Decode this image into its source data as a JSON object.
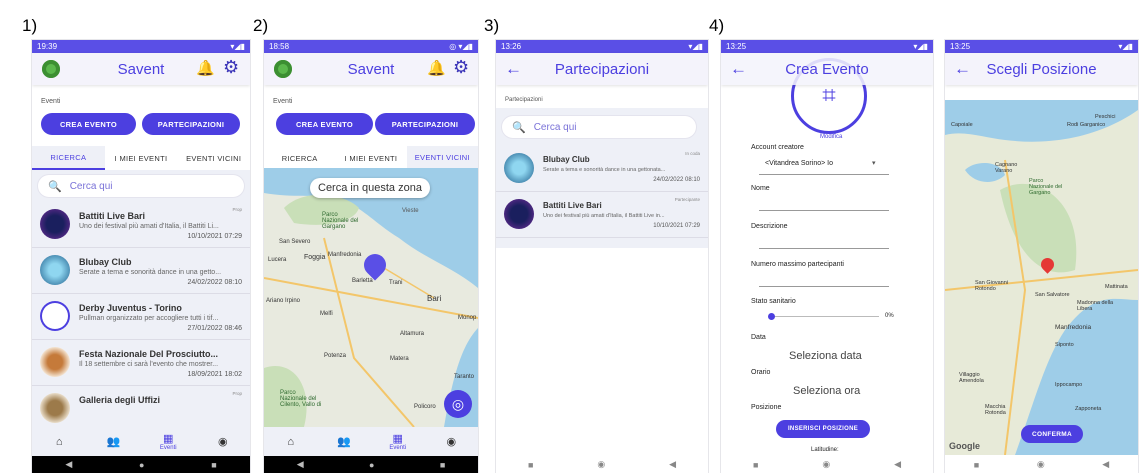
{
  "labels": {
    "one": "1)",
    "two": "2)",
    "three": "3)",
    "four": "4)"
  },
  "colors": {
    "primary": "#4c3fe0",
    "statusbar": "#5a4fe6",
    "listbg": "#eef0f7"
  },
  "screen1": {
    "time": "19:39",
    "app_title": "Savent",
    "section_label": "Eventi",
    "btn_create": "CREA EVENTO",
    "btn_part": "PARTECIPAZIONI",
    "tabs": [
      "RICERCA",
      "I MIEI EVENTI",
      "EVENTI VICINI"
    ],
    "search_placeholder": "Cerca qui",
    "events": [
      {
        "title": "Battiti Live Bari",
        "desc": "Uno dei festival più amati d'Italia, il Battiti Li...",
        "date": "10/10/2021 07:29",
        "tag": "Prop"
      },
      {
        "title": "Blubay Club",
        "desc": "Serate a tema e sonorità dance in una getto...",
        "date": "24/02/2022 08:10",
        "tag": ""
      },
      {
        "title": "Derby Juventus - Torino",
        "desc": "Pullman organizzato per accogliere tutti i tif...",
        "date": "27/01/2022 08:46",
        "tag": ""
      },
      {
        "title": "Festa Nazionale Del Prosciutto...",
        "desc": "Il 18 settembre ci sarà l'evento che mostrer...",
        "date": "18/09/2021 18:02",
        "tag": ""
      },
      {
        "title": "Galleria degli Uffizi",
        "desc": "",
        "date": "",
        "tag": "Prop"
      }
    ],
    "nav_label": "Eventi"
  },
  "screen2": {
    "time": "18:58",
    "app_title": "Savent",
    "section_label": "Eventi",
    "btn_create": "CREA EVENTO",
    "btn_part": "PARTECIPAZIONI",
    "tabs": [
      "RICERCA",
      "I MIEI EVENTI",
      "EVENTI VICINI"
    ],
    "map_search": "Cerca in questa zona",
    "places": [
      "Vieste",
      "Parco Nazionale del Gargano",
      "San Severo",
      "Manfredonia",
      "Lucera",
      "Foggia",
      "Barletta",
      "Trani",
      "Bari",
      "Ariano Irpino",
      "Melfi",
      "Monop",
      "Altamura",
      "Potenza",
      "Matera",
      "Taranto",
      "Parco Nazionale del Cilento, Vallo di",
      "Policoro"
    ],
    "nav_label": "Eventi"
  },
  "screen3": {
    "time": "13:26",
    "title": "Partecipazioni",
    "section_label": "Partecipazioni",
    "search_placeholder": "Cerca qui",
    "events": [
      {
        "title": "Blubay Club",
        "desc": "Serate a tema e sonorità dance in una gettonata...",
        "date": "24/02/2022 08:10",
        "tag": "In coda"
      },
      {
        "title": "Battiti Live Bari",
        "desc": "Uno dei festival più amati d'Italia, il Battiti Live in...",
        "date": "10/10/2021 07:29",
        "tag": "Partecipante"
      }
    ]
  },
  "screen4": {
    "time": "13:25",
    "title": "Crea Evento",
    "modifica": "Modifica",
    "account_label": "Account creatore",
    "account_value": "<Vitandrea Sorino> Io",
    "nome": "Nome",
    "descrizione": "Descrizione",
    "numero": "Numero massimo partecipanti",
    "stato": "Stato sanitario",
    "stato_pct": "0%",
    "stato_value": 0,
    "data": "Data",
    "data_value": "Seleziona data",
    "orario": "Orario",
    "orario_value": "Seleziona ora",
    "posizione": "Posizione",
    "btn_pos": "INSERISCI POSIZIONE",
    "latitudine": "Latitudine:"
  },
  "screen5": {
    "time": "13:25",
    "title": "Scegli Posizione",
    "places": [
      "Peschici",
      "Rodi Garganico",
      "Capoiale",
      "Cagnano Varano",
      "Parco Nazionale del Gargano",
      "San Giovanni Rotondo",
      "San Salvatore",
      "Mattinata",
      "Madonna della Libera",
      "Manfredonia",
      "Siponto",
      "Villaggio Amendola",
      "Ippocampo",
      "Macchia Rotonda",
      "Zapponeta"
    ],
    "btn": "CONFERMA",
    "google": "Google"
  }
}
